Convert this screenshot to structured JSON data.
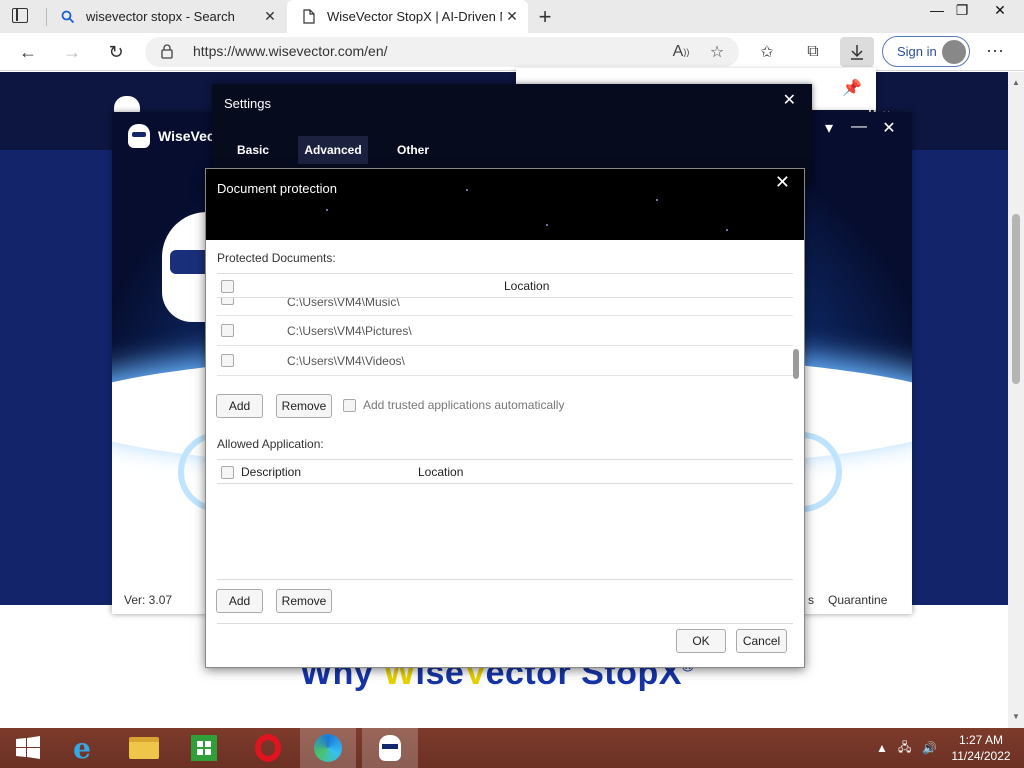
{
  "browser": {
    "tabs": [
      {
        "label": "wisevector stopx - Search",
        "icon": "search-icon"
      },
      {
        "label": "WiseVector StopX | AI-Driven Ma",
        "icon": "page-icon"
      }
    ],
    "url": "https://www.wisevector.com/en/",
    "sign_in": "Sign in"
  },
  "webpage": {
    "headline_part1": "Why ",
    "headline_w": "W",
    "headline_part2": "ise",
    "headline_v": "V",
    "headline_part3": "ector StopX",
    "headline_reg": "®",
    "nav_fragment": "h ⌄"
  },
  "app": {
    "name": "WiseVec",
    "version": "Ver: 3.07",
    "quarantine": "Quarantine",
    "frag": "s"
  },
  "settings": {
    "title": "Settings",
    "tabs": [
      "Basic",
      "Advanced",
      "Other"
    ],
    "active_tab": "Advanced"
  },
  "dialog": {
    "title": "Document protection",
    "protected_label": "Protected Documents:",
    "protected_header": "Location",
    "protected_rows": [
      "C:\\Users\\VM4\\Music\\",
      "C:\\Users\\VM4\\Pictures\\",
      "C:\\Users\\VM4\\Videos\\"
    ],
    "add": "Add",
    "remove": "Remove",
    "trusted_label": "Add trusted applications automatically",
    "allowed_label": "Allowed Application:",
    "allowed_headers": [
      "Description",
      "Location"
    ],
    "ok": "OK",
    "cancel": "Cancel"
  },
  "taskbar": {
    "time": "1:27 AM",
    "date": "11/24/2022"
  }
}
